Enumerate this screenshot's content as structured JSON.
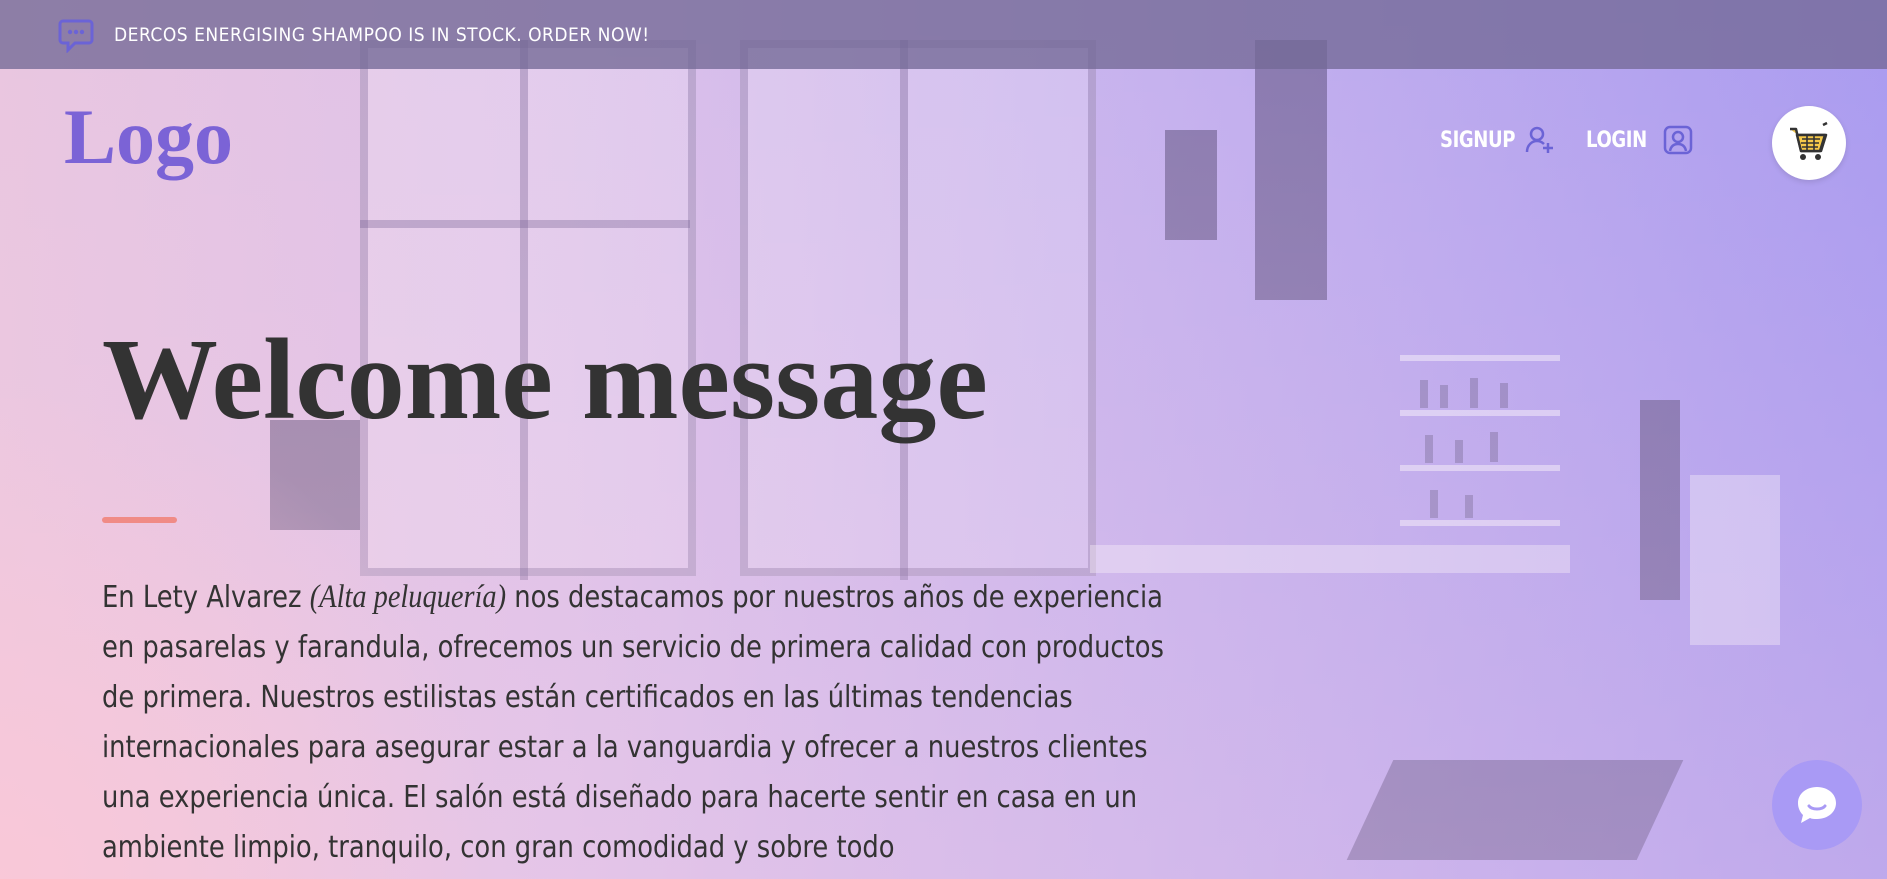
{
  "announcement": {
    "icon": "chat-bubble-icon",
    "text": "DERCOS ENERGISING SHAMPOO IS IN STOCK. ORDER NOW!"
  },
  "header": {
    "logo": "Logo",
    "signup_label": "SIGNUP",
    "login_label": "LOGIN",
    "cart_icon": "shopping-cart-icon"
  },
  "hero": {
    "title": "Welcome message",
    "intro_before": "En Lety Alvarez ",
    "intro_em": "(Alta peluquería)",
    "intro_after": " nos destacamos por nuestros años de experiencia en pasarelas y farandula, ofrecemos un servicio de primera calidad con productos de primera. Nuestros estilistas están certificados en las últimas tendencias internacionales para asegurar estar a la vanguardia y ofrecer a nuestros clientes una experiencia única. El salón está diseñado para hacerte sentir en casa en un ambiente limpio, tranquilo, con gran comodidad y sobre todo"
  },
  "colors": {
    "accent": "#7b63d6",
    "divider": "#f08b86",
    "chat_button": "#a99af5",
    "title_text": "#333333"
  }
}
